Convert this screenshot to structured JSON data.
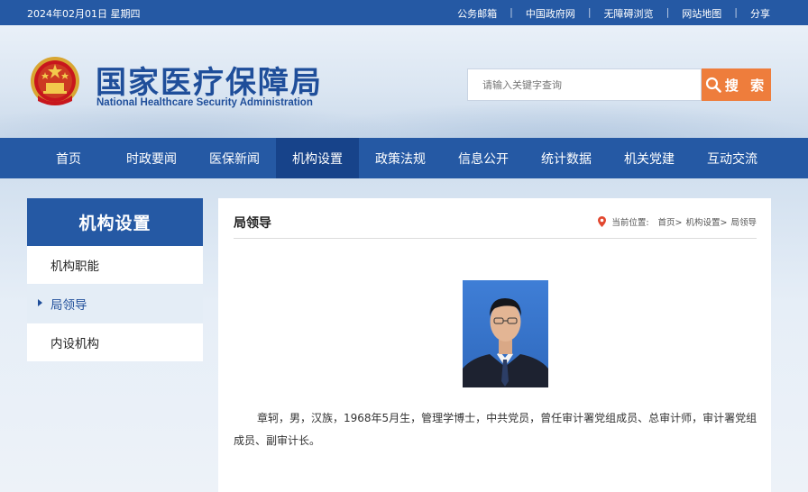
{
  "topbar": {
    "date": "2024年02月01日 星期四",
    "links": [
      "公务邮箱",
      "中国政府网",
      "无障碍浏览",
      "网站地图",
      "分享"
    ]
  },
  "header": {
    "title_cn": "国家医疗保障局",
    "title_en": "National Healthcare Security Administration",
    "search_placeholder": "请输入关键字查询",
    "search_button": "搜 索"
  },
  "nav": {
    "items": [
      "首页",
      "时政要闻",
      "医保新闻",
      "机构设置",
      "政策法规",
      "信息公开",
      "统计数据",
      "机关党建",
      "互动交流"
    ],
    "active_index": 3
  },
  "sidebar": {
    "title": "机构设置",
    "items": [
      "机构职能",
      "局领导",
      "内设机构"
    ],
    "active_index": 1
  },
  "main": {
    "title": "局领导",
    "breadcrumb": {
      "prefix": "当前位置:",
      "path": [
        "首页>",
        "机构设置>",
        "局领导"
      ]
    },
    "bio": "章轲，男，汉族，1968年5月生，管理学博士，中共党员，曾任审计署党组成员、总审计师，审计署党组成员、副审计长。"
  },
  "colors": {
    "primary": "#2559a4",
    "nav_active": "#17438a",
    "search_button": "#ee7d3c"
  }
}
